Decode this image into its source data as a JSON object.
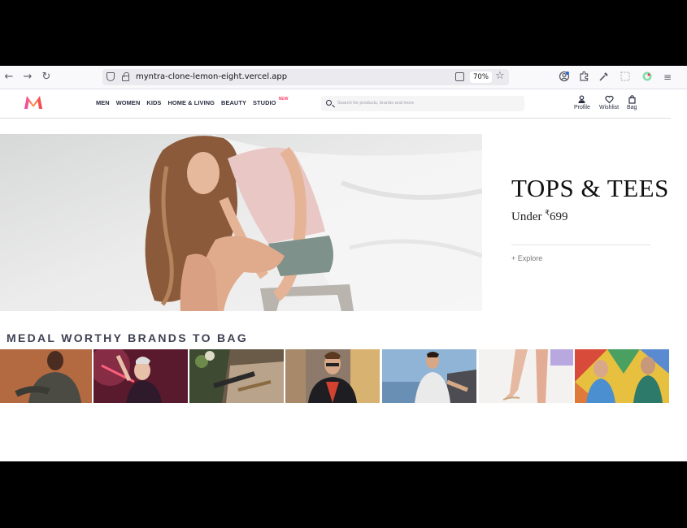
{
  "browser": {
    "url": "myntra-clone-lemon-eight.vercel.app",
    "zoom": "70%",
    "icons": [
      "back-icon",
      "forward-icon",
      "reload-icon",
      "shield-icon",
      "lock-icon",
      "download-icon",
      "star-icon",
      "account-icon",
      "extensions-icon",
      "eyedropper-icon",
      "screenshot-icon",
      "colorpicker-icon",
      "menu-icon"
    ]
  },
  "header": {
    "logo_text": "M",
    "menu": [
      {
        "label": "MEN"
      },
      {
        "label": "WOMEN"
      },
      {
        "label": "KIDS"
      },
      {
        "label": "HOME & LIVING"
      },
      {
        "label": "BEAUTY"
      },
      {
        "label": "STUDIO",
        "badge": "NEW"
      }
    ],
    "search_placeholder": "Search for products, brands and more",
    "actions": [
      {
        "label": "Profile",
        "icon": "profile-icon"
      },
      {
        "label": "Wishlist",
        "icon": "heart-icon"
      },
      {
        "label": "Bag",
        "icon": "bag-icon"
      }
    ]
  },
  "hero": {
    "title": "TOPS & TEES",
    "subtitle_prefix": "Under ",
    "currency": "₹",
    "price": "699",
    "cta": "+ Explore"
  },
  "brands_section": {
    "title": "MEDAL WORTHY BRANDS TO BAG",
    "tiles_count": 7
  },
  "colors": {
    "accent": "#ff3f6c",
    "text": "#282c3f"
  }
}
